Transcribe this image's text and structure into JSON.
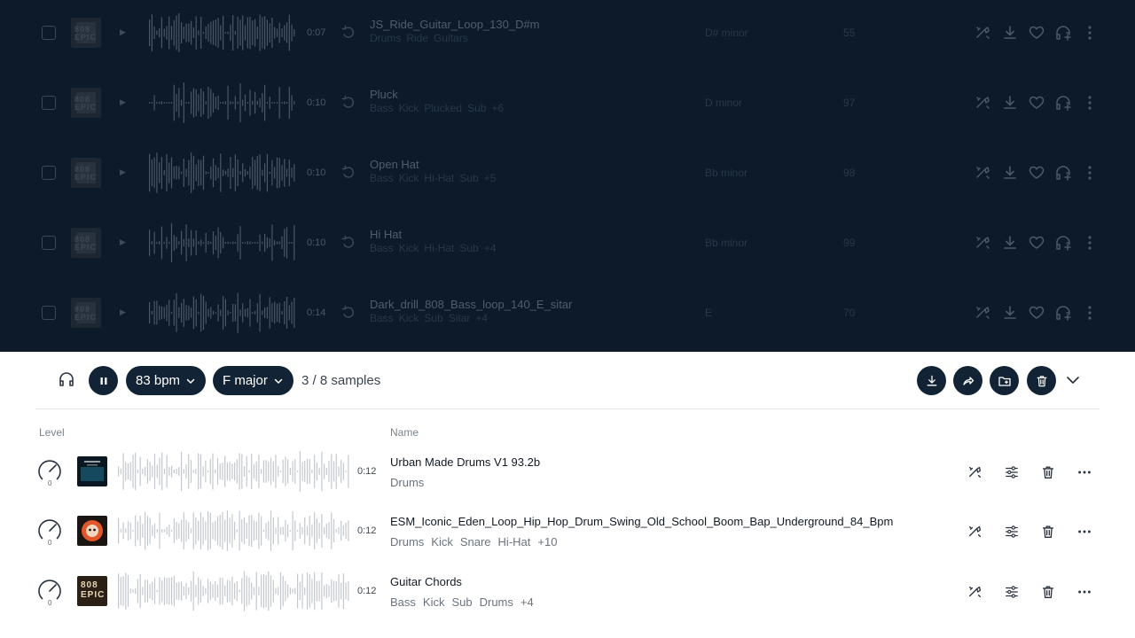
{
  "colors": {
    "dark_panel": "#0c1a2a",
    "pill": "#112334",
    "text_primary": "#111a24",
    "text_muted": "#6b747e"
  },
  "library": {
    "rows": [
      {
        "duration": "0:07",
        "name": "JS_Ride_Guitar_Loop_130_D#m",
        "tags": [
          "Drums",
          "Ride",
          "Guitars"
        ],
        "key": "D# minor",
        "bpm": "55"
      },
      {
        "duration": "0:10",
        "name": "Pluck",
        "tags": [
          "Bass",
          "Kick",
          "Plucked",
          "Sub",
          "+6"
        ],
        "key": "D minor",
        "bpm": "97"
      },
      {
        "duration": "0:10",
        "name": "Open Hat",
        "tags": [
          "Bass",
          "Kick",
          "Hi-Hat",
          "Sub",
          "+5"
        ],
        "key": "Bb minor",
        "bpm": "98"
      },
      {
        "duration": "0:10",
        "name": "Hi Hat",
        "tags": [
          "Bass",
          "Kick",
          "Hi-Hat",
          "Sub",
          "+4"
        ],
        "key": "Bb minor",
        "bpm": "99"
      },
      {
        "duration": "0:14",
        "name": "Dark_drill_808_Bass_loop_140_E_sitar",
        "tags": [
          "Bass",
          "Kick",
          "Sub",
          "Sitar",
          "+4"
        ],
        "key": "E",
        "bpm": "70"
      }
    ],
    "thumb_text": "808 EPIC"
  },
  "toolbar": {
    "bpm_label": "83 bpm",
    "key_label": "F major",
    "count_label": "3 / 8 samples",
    "icons": [
      "headphones-icon",
      "pause-icon",
      "download-icon",
      "share-icon",
      "folder-add-icon",
      "trash-icon",
      "chevron-down-icon"
    ]
  },
  "stack": {
    "col_level": "Level",
    "col_name": "Name",
    "rows": [
      {
        "level": "0",
        "duration": "0:12",
        "name": "Urban Made Drums V1 93.2b",
        "tags": [
          "Drums"
        ]
      },
      {
        "level": "0",
        "duration": "0:12",
        "name": "ESM_Iconic_Eden_Loop_Hip_Hop_Drum_Swing_Old_School_Boom_Bap_Underground_84_Bpm",
        "tags": [
          "Drums",
          "Kick",
          "Snare",
          "Hi-Hat",
          "+10"
        ]
      },
      {
        "level": "0",
        "duration": "0:12",
        "name": "Guitar Chords",
        "tags": [
          "Bass",
          "Kick",
          "Sub",
          "Drums",
          "+4"
        ]
      }
    ],
    "thumb_text": "808 EPIC"
  }
}
